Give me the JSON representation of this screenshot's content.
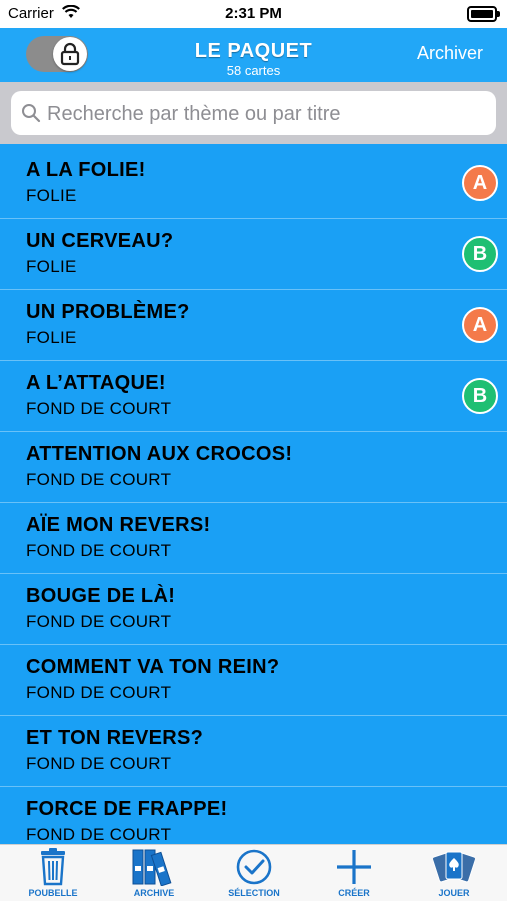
{
  "status_bar": {
    "carrier": "Carrier",
    "time": "2:31 PM"
  },
  "nav": {
    "title": "LE PAQUET",
    "subtitle": "58 cartes",
    "archive_label": "Archiver"
  },
  "search": {
    "placeholder": "Recherche par thème ou par titre",
    "value": ""
  },
  "cards": [
    {
      "title": "A LA FOLIE!",
      "theme": "FOLIE",
      "badge": "A"
    },
    {
      "title": "UN CERVEAU?",
      "theme": "FOLIE",
      "badge": "B"
    },
    {
      "title": "UN PROBLÈME?",
      "theme": "FOLIE",
      "badge": "A"
    },
    {
      "title": "A L’ATTAQUE!",
      "theme": "FOND DE COURT",
      "badge": "B"
    },
    {
      "title": "ATTENTION AUX CROCOS!",
      "theme": "FOND DE COURT",
      "badge": ""
    },
    {
      "title": "AÏE MON REVERS!",
      "theme": "FOND DE COURT",
      "badge": ""
    },
    {
      "title": "BOUGE DE LÀ!",
      "theme": "FOND DE COURT",
      "badge": ""
    },
    {
      "title": "COMMENT VA TON REIN?",
      "theme": "FOND DE COURT",
      "badge": ""
    },
    {
      "title": "ET TON REVERS?",
      "theme": "FOND DE COURT",
      "badge": ""
    },
    {
      "title": "FORCE DE FRAPPE!",
      "theme": "FOND DE COURT",
      "badge": ""
    }
  ],
  "badge_colors": {
    "A": "#f47a4a",
    "B": "#1fbf73"
  },
  "tabs": [
    {
      "label": "POUBELLE",
      "icon": "trash-icon"
    },
    {
      "label": "ARCHIVE",
      "icon": "archive-icon"
    },
    {
      "label": "SÉLECTION",
      "icon": "check-circle-icon"
    },
    {
      "label": "CRÉER",
      "icon": "plus-icon"
    },
    {
      "label": "JOUER",
      "icon": "cards-icon"
    }
  ]
}
